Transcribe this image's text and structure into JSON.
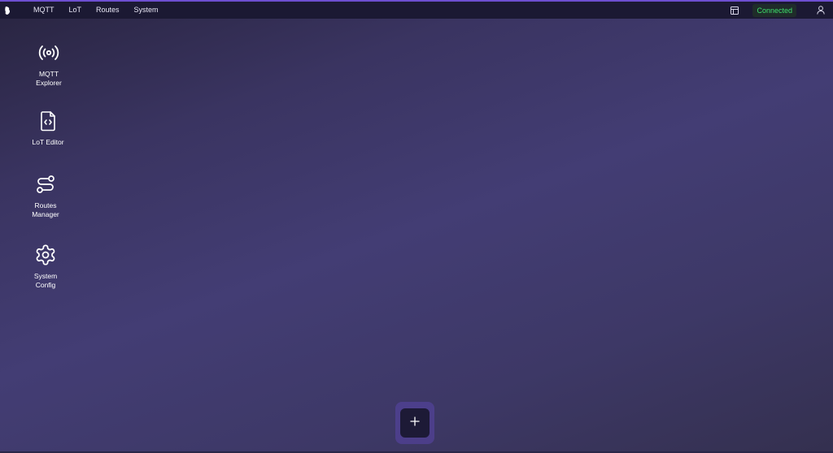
{
  "topbar": {
    "logo_icon": "app-logo-icon",
    "menu": [
      {
        "label": "MQTT"
      },
      {
        "label": "LoT"
      },
      {
        "label": "Routes"
      },
      {
        "label": "System"
      }
    ],
    "layout_icon": "layout-panel-icon",
    "status": "Connected",
    "status_color": "#3ee06b",
    "user_icon": "user-icon",
    "accent": "#6d4fd1"
  },
  "desktop": {
    "icons": [
      {
        "label": "MQTT\nExplorer",
        "icon": "broadcast-icon"
      },
      {
        "label": "LoT Editor",
        "icon": "code-file-icon"
      },
      {
        "label": "Routes\nManager",
        "icon": "route-icon"
      },
      {
        "label": "System\nConfig",
        "icon": "gear-icon"
      }
    ]
  },
  "fab": {
    "icon": "plus-icon"
  }
}
